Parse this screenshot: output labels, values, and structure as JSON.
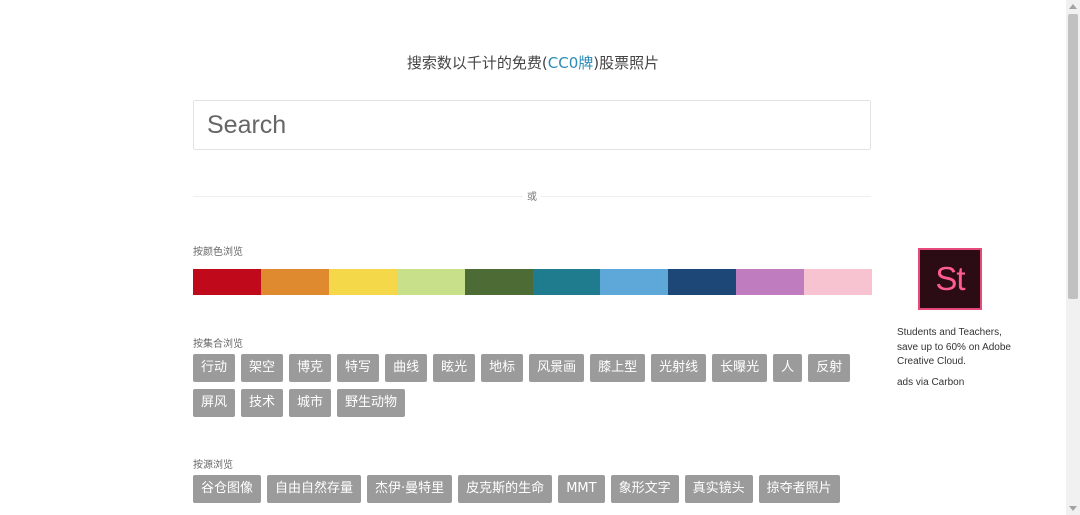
{
  "header": {
    "tagline_prefix": "搜索数以千计的免费(",
    "tagline_license": "CC0牌",
    "tagline_suffix": ")股票照片"
  },
  "search": {
    "placeholder": "Search"
  },
  "divider": {
    "or_label": "或"
  },
  "browse_color": {
    "label": "按颜色浏览",
    "swatches": [
      "#c0091b",
      "#e08a2f",
      "#f5d84a",
      "#c9e08a",
      "#4d6b35",
      "#1f7b8e",
      "#5ea7d9",
      "#1c4777",
      "#bf7dbf",
      "#f7c3d1"
    ]
  },
  "browse_collection": {
    "label": "按集合浏览",
    "tags": [
      "行动",
      "架空",
      "博克",
      "特写",
      "曲线",
      "眩光",
      "地标",
      "风景画",
      "膝上型",
      "光射线",
      "长曝光",
      "人",
      "反射",
      "屏风",
      "技术",
      "城市",
      "野生动物"
    ]
  },
  "browse_source": {
    "label": "按源浏览",
    "tags": [
      "谷仓图像",
      "自由自然存量",
      "杰伊·曼特里",
      "皮克斯的生命",
      "MMT",
      "象形文字",
      "真实镜头",
      "掠夺者照片"
    ]
  },
  "ad": {
    "logo_text": "St",
    "text": "Students and Teachers, save up to 60% on Adobe Creative Cloud.",
    "via": "ads via Carbon"
  },
  "colors": {
    "tag_bg": "#9b9b9b",
    "license_link": "#2a8bb5",
    "ad_logo_bg": "#2b0c14",
    "ad_logo_accent": "#e64a7d"
  }
}
